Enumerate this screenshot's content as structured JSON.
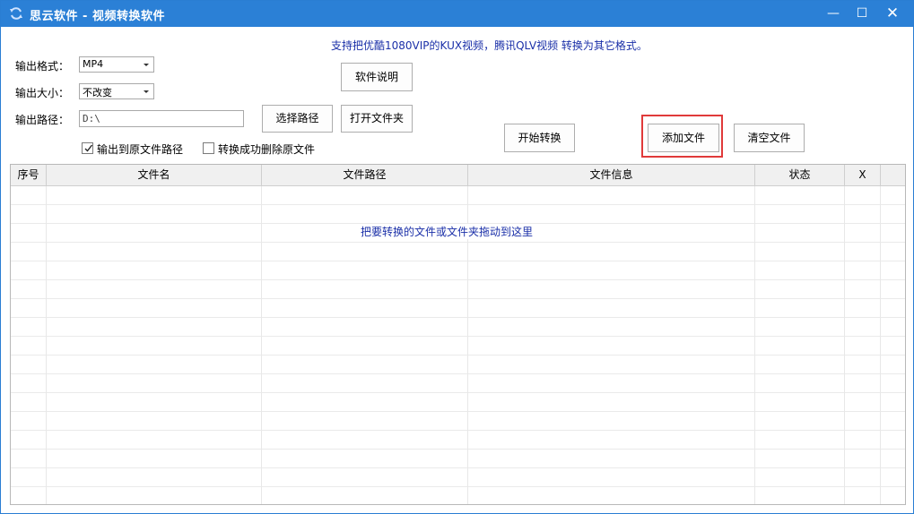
{
  "window": {
    "title": "思云软件 - 视频转换软件",
    "minimize": "—",
    "maximize": "☐",
    "close": "✕",
    "accent": "#2b80d6"
  },
  "notice": "支持把优酷1080VIP的KUX视频，腾讯QLV视频 转换为其它格式。",
  "form": {
    "format_label": "输出格式：",
    "format_value": "MP4",
    "size_label": "输出大小：",
    "size_value": "不改变",
    "path_label": "输出路径：",
    "path_value": "D:\\"
  },
  "buttons": {
    "help": "软件说明",
    "choose_path": "选择路径",
    "open_folder": "打开文件夹",
    "start": "开始转换",
    "add_file": "添加文件",
    "clear_file": "清空文件"
  },
  "checkboxes": {
    "output_to_source": {
      "label": "输出到原文件路径",
      "checked": true
    },
    "delete_source": {
      "label": "转换成功删除原文件",
      "checked": false
    }
  },
  "table": {
    "columns": [
      "序号",
      "文件名",
      "文件路径",
      "文件信息",
      "状态",
      "X"
    ],
    "drop_hint": "把要转换的文件或文件夹拖动到这里",
    "rows": []
  },
  "colors": {
    "highlight": "#e03a3a",
    "notice_text": "#1a2fa8"
  }
}
